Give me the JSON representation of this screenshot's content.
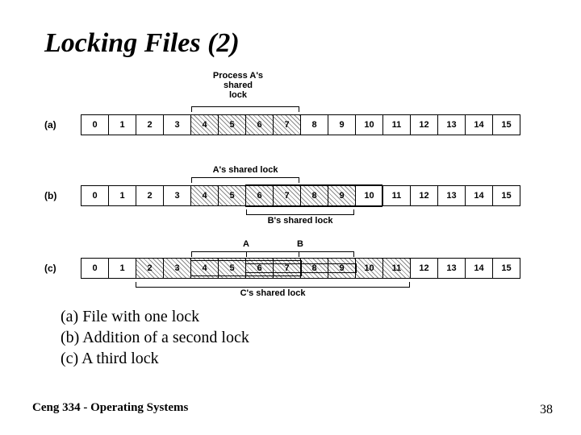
{
  "title": "Locking Files (2)",
  "diagram": {
    "cells": [
      "0",
      "1",
      "2",
      "3",
      "4",
      "5",
      "6",
      "7",
      "8",
      "9",
      "10",
      "11",
      "12",
      "13",
      "14",
      "15"
    ],
    "rows": {
      "a": {
        "label": "(a)"
      },
      "b": {
        "label": "(b)"
      },
      "c": {
        "label": "(c)"
      }
    },
    "labels": {
      "procA": "Process A's\nshared\nlock",
      "aShared": "A's shared lock",
      "bShared": "B's shared lock",
      "cShared": "C's shared lock",
      "smallA": "A",
      "smallB": "B"
    }
  },
  "caption": {
    "line1": "(a) File with one lock",
    "line2": "(b) Addition of a second lock",
    "line3": "(c) A third lock"
  },
  "footer": {
    "course": "Ceng 334 - Operating Systems",
    "page": "38"
  }
}
